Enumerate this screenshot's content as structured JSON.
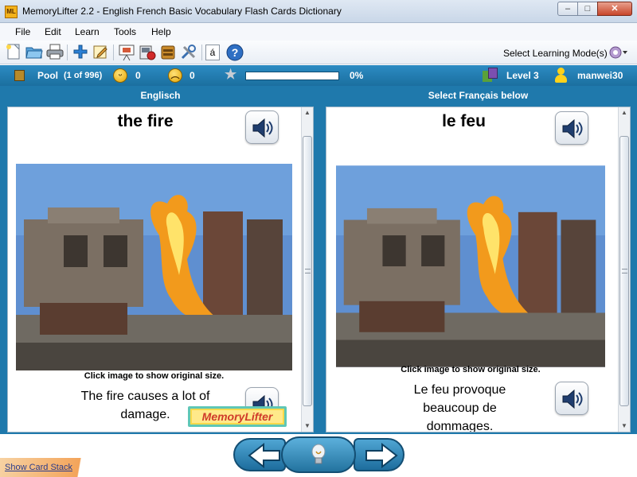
{
  "window": {
    "title": "MemoryLifter 2.2 - English French Basic Vocabulary Flash Cards Dictionary",
    "app_icon_text": "ML",
    "minimize": "–",
    "maximize": "□",
    "close": "✕"
  },
  "menu": [
    "File",
    "Edit",
    "Learn",
    "Tools",
    "Help"
  ],
  "toolbar": {
    "icons": [
      "new-file-icon",
      "open-folder-icon",
      "print-icon",
      "add-card-icon",
      "edit-card-icon",
      "presentation-icon",
      "slideshow-icon",
      "card-stack-icon",
      "tools-icon",
      "character-map-icon",
      "help-icon"
    ],
    "char_map_label": "á",
    "learning_mode_label": "Select Learning Mode(s)"
  },
  "status": {
    "pool_label": "Pool",
    "pool_count": "(1 of 996)",
    "correct_count": "0",
    "wrong_count": "0",
    "progress_fraction": 0,
    "progress_text": "0%",
    "level": "Level 3",
    "user": "manwei30",
    "colors": {
      "status_bg": "#1f79ac",
      "progress_fill": "#7fc24a"
    }
  },
  "question": {
    "header": "Englisch",
    "word": "the fire",
    "caption": "Click image to show original size.",
    "sentence": "The fire causes a lot of damage.",
    "watermark": "MemoryLifter"
  },
  "answer": {
    "header": "Select Français below",
    "word": "le feu",
    "caption": "Click image to show original size.",
    "sentence": "Le feu provoque beaucoup de dommages."
  },
  "navigation": {
    "back_icon": "left-arrow-icon",
    "hint_icon": "lightbulb-icon",
    "next_icon": "right-arrow-icon",
    "show_card_stack": "Show Card Stack"
  }
}
